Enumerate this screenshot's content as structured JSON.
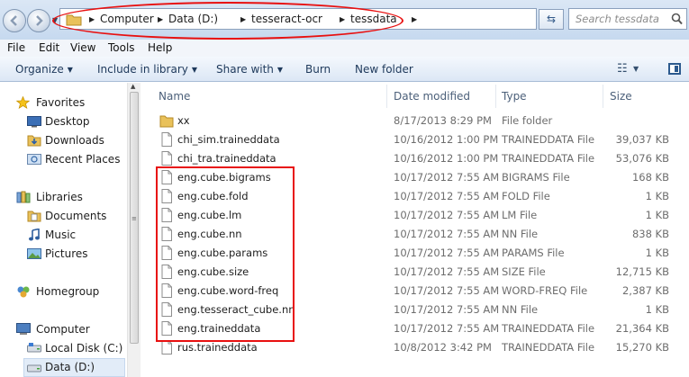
{
  "address_bar": {
    "breadcrumb": [
      "Computer",
      "Data (D:)",
      "tesseract-ocr",
      "tessdata"
    ],
    "search_placeholder": "Search tessdata",
    "refresh_icon": "refresh-icon"
  },
  "menu": [
    "File",
    "Edit",
    "View",
    "Tools",
    "Help"
  ],
  "toolbar": {
    "organize": "Organize",
    "include": "Include in library",
    "share": "Share with",
    "burn": "Burn",
    "new_folder": "New folder"
  },
  "nav": {
    "favorites": "Favorites",
    "desktop": "Desktop",
    "downloads": "Downloads",
    "recent": "Recent Places",
    "libraries": "Libraries",
    "documents": "Documents",
    "music": "Music",
    "pictures": "Pictures",
    "homegroup": "Homegroup",
    "computer": "Computer",
    "local_disk": "Local Disk (C:)",
    "data_drive": "Data (D:)"
  },
  "columns": {
    "name": "Name",
    "date": "Date modified",
    "type": "Type",
    "size": "Size"
  },
  "files": [
    {
      "name": "xx",
      "date": "8/17/2013 8:29 PM",
      "type": "File folder",
      "size": "",
      "icon": "folder-icon"
    },
    {
      "name": "chi_sim.traineddata",
      "date": "10/16/2012 1:00 PM",
      "type": "TRAINEDDATA File",
      "size": "39,037 KB",
      "icon": "file-icon"
    },
    {
      "name": "chi_tra.traineddata",
      "date": "10/16/2012 1:00 PM",
      "type": "TRAINEDDATA File",
      "size": "53,076 KB",
      "icon": "file-icon"
    },
    {
      "name": "eng.cube.bigrams",
      "date": "10/17/2012 7:55 AM",
      "type": "BIGRAMS File",
      "size": "168 KB",
      "icon": "file-icon"
    },
    {
      "name": "eng.cube.fold",
      "date": "10/17/2012 7:55 AM",
      "type": "FOLD File",
      "size": "1 KB",
      "icon": "file-icon"
    },
    {
      "name": "eng.cube.lm",
      "date": "10/17/2012 7:55 AM",
      "type": "LM File",
      "size": "1 KB",
      "icon": "file-icon"
    },
    {
      "name": "eng.cube.nn",
      "date": "10/17/2012 7:55 AM",
      "type": "NN File",
      "size": "838 KB",
      "icon": "file-icon"
    },
    {
      "name": "eng.cube.params",
      "date": "10/17/2012 7:55 AM",
      "type": "PARAMS File",
      "size": "1 KB",
      "icon": "file-icon"
    },
    {
      "name": "eng.cube.size",
      "date": "10/17/2012 7:55 AM",
      "type": "SIZE File",
      "size": "12,715 KB",
      "icon": "file-icon"
    },
    {
      "name": "eng.cube.word-freq",
      "date": "10/17/2012 7:55 AM",
      "type": "WORD-FREQ File",
      "size": "2,387 KB",
      "icon": "file-icon"
    },
    {
      "name": "eng.tesseract_cube.nn",
      "date": "10/17/2012 7:55 AM",
      "type": "NN File",
      "size": "1 KB",
      "icon": "file-icon"
    },
    {
      "name": "eng.traineddata",
      "date": "10/17/2012 7:55 AM",
      "type": "TRAINEDDATA File",
      "size": "21,364 KB",
      "icon": "file-icon"
    },
    {
      "name": "rus.traineddata",
      "date": "10/8/2012 3:42 PM",
      "type": "TRAINEDDATA File",
      "size": "15,270 KB",
      "icon": "file-icon"
    }
  ],
  "annotation_color": "#e81010"
}
